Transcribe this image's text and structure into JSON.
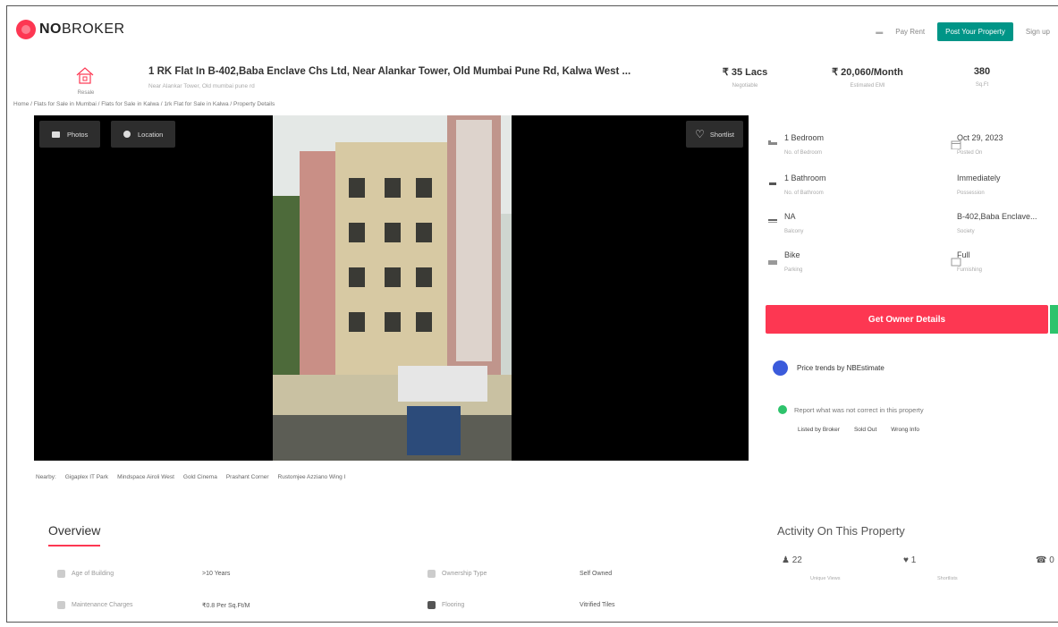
{
  "header": {
    "logo_bold": "NO",
    "logo_rest": "BROKER",
    "nav_links": [
      "Pay Rent"
    ],
    "post_button": "Post Your Property",
    "signup": "Sign up"
  },
  "property": {
    "type_label": "Resale",
    "title": "1 RK Flat In B-402,Baba Enclave Chs Ltd, Near Alankar Tower, Old Mumbai Pune Rd, Kalwa West ...",
    "subtitle": "Near Alankar Tower, Old mumbai pune rd",
    "stats": [
      {
        "value": "₹ 35 Lacs",
        "label": "Negotiable"
      },
      {
        "value": "₹ 20,060/Month",
        "label": "Estimated EMI"
      },
      {
        "value": "380",
        "label": "Sq.Ft"
      }
    ]
  },
  "breadcrumb": "Home / Flats for Sale in Mumbai / Flats for Sale in Kalwa / 1rk Flat for Sale in Kalwa / Property Details",
  "gallery": {
    "photos_button": "Photos",
    "location_button": "Location",
    "shortlist_button": "Shortlist"
  },
  "details": [
    {
      "value": "1 Bedroom",
      "label": "No. of Bedroom",
      "icon": "bed-icon"
    },
    {
      "value": "Oct 29, 2023",
      "label": "Posted On",
      "icon": "calendar-icon"
    },
    {
      "value": "1 Bathroom",
      "label": "No. of Bathroom",
      "icon": "bath-icon"
    },
    {
      "value": "Immediately",
      "label": "Possession",
      "icon": "key-icon"
    },
    {
      "value": "NA",
      "label": "Balcony",
      "icon": "balcony-icon"
    },
    {
      "value": "B-402,Baba Enclave...",
      "label": "Society",
      "icon": "building-icon"
    },
    {
      "value": "Bike",
      "label": "Parking",
      "icon": "parking-icon"
    },
    {
      "value": "Full",
      "label": "Furnishing",
      "icon": "sofa-icon"
    }
  ],
  "actions": {
    "owner_button": "Get Owner Details",
    "price_trends": "Price trends by NBEstimate",
    "report_text": "Report what was not correct in this property",
    "report_links": [
      "Listed by Broker",
      "Sold Out",
      "Wrong Info"
    ]
  },
  "nearby": {
    "label": "Nearby:",
    "places": [
      "Gigaplex IT Park",
      "Mindspace Airoli West",
      "Gold Cinema",
      "Prashant Corner",
      "Rustomjee Azziano Wing I"
    ]
  },
  "overview": {
    "heading": "Overview",
    "items": [
      {
        "label": "Age of Building",
        "value": ">10 Years"
      },
      {
        "label": "Ownership Type",
        "value": "Self Owned"
      },
      {
        "label": "Maintenance Charges",
        "value": "₹0.8 Per Sq.Ft/M"
      },
      {
        "label": "Flooring",
        "value": "Vitrified Tiles"
      }
    ]
  },
  "activity": {
    "heading": "Activity On This Property",
    "items": [
      {
        "value": "22",
        "label": "Unique Views"
      },
      {
        "value": "1",
        "label": "Shortlists"
      },
      {
        "value": "0",
        "label": ""
      }
    ]
  },
  "colors": {
    "brand": "#fd3752",
    "accent_green": "#009587"
  }
}
